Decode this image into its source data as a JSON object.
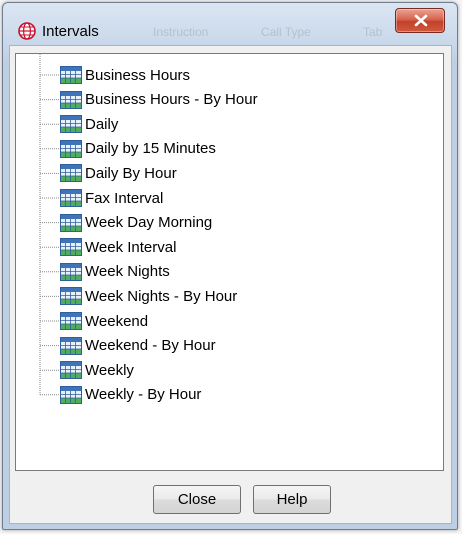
{
  "window": {
    "title": "Intervals",
    "background_hint": [
      "Instruction",
      "Call Type",
      "Tab"
    ]
  },
  "tree": {
    "items": [
      {
        "label": "Business Hours",
        "icon": "calendar-grid-icon"
      },
      {
        "label": "Business Hours - By Hour",
        "icon": "calendar-grid-icon"
      },
      {
        "label": "Daily",
        "icon": "calendar-grid-icon"
      },
      {
        "label": "Daily by 15 Minutes",
        "icon": "calendar-grid-icon"
      },
      {
        "label": "Daily By Hour",
        "icon": "calendar-grid-icon"
      },
      {
        "label": "Fax Interval",
        "icon": "calendar-grid-icon"
      },
      {
        "label": "Week Day Morning",
        "icon": "calendar-grid-icon"
      },
      {
        "label": "Week Interval",
        "icon": "calendar-grid-icon"
      },
      {
        "label": "Week Nights",
        "icon": "calendar-grid-icon"
      },
      {
        "label": "Week Nights - By Hour",
        "icon": "calendar-grid-icon"
      },
      {
        "label": "Weekend",
        "icon": "calendar-grid-icon"
      },
      {
        "label": "Weekend - By Hour",
        "icon": "calendar-grid-icon"
      },
      {
        "label": "Weekly",
        "icon": "calendar-grid-icon"
      },
      {
        "label": "Weekly - By Hour",
        "icon": "calendar-grid-icon"
      }
    ]
  },
  "buttons": {
    "close_label": "Close",
    "help_label": "Help"
  },
  "colors": {
    "title_bar": "#c9d8ea",
    "close_button": "#c2412a",
    "icon_blue": "#3f74b8",
    "icon_green": "#4fae5c"
  }
}
